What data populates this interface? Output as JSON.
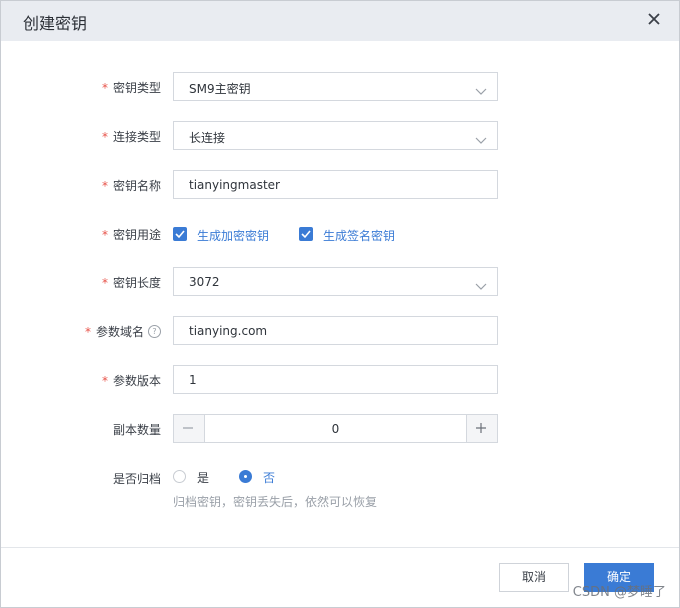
{
  "dialog": {
    "title": "创建密钥"
  },
  "form": {
    "key_type": {
      "label": "密钥类型",
      "required": "*",
      "value": "SM9主密钥"
    },
    "connection_type": {
      "label": "连接类型",
      "required": "*",
      "value": "长连接"
    },
    "key_name": {
      "label": "密钥名称",
      "required": "*",
      "value": "tianyingmaster"
    },
    "key_usage": {
      "label": "密钥用途",
      "required": "*",
      "options": [
        {
          "label": "生成加密密钥",
          "checked": true
        },
        {
          "label": "生成签名密钥",
          "checked": true
        }
      ]
    },
    "key_length": {
      "label": "密钥长度",
      "required": "*",
      "value": "3072"
    },
    "param_domain": {
      "label": "参数域名",
      "required": "*",
      "help_icon": "?",
      "value": "tianying.com"
    },
    "param_version": {
      "label": "参数版本",
      "required": "*",
      "value": "1"
    },
    "replica_count": {
      "label": "副本数量",
      "value": "0"
    },
    "archive": {
      "label": "是否归档",
      "options": [
        {
          "label": "是",
          "selected": false
        },
        {
          "label": "否",
          "selected": true
        }
      ],
      "hint": "归档密钥，密钥丢失后，依然可以恢复"
    }
  },
  "footer": {
    "cancel_label": "取消",
    "ok_label": "确定"
  },
  "watermark": "CSDN @梦睡了",
  "colors": {
    "accent": "#3a7bd5",
    "required": "#e8534a",
    "header_bg": "#e9ecf1"
  }
}
